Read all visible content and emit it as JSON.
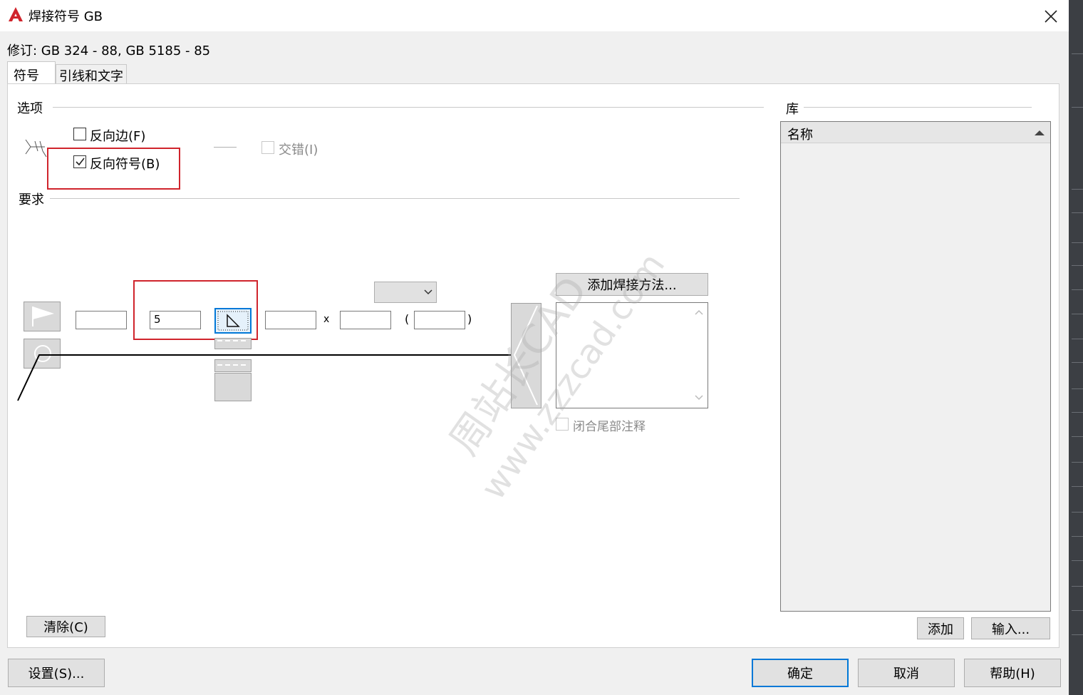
{
  "window": {
    "title": "焊接符号 GB",
    "app_icon": "autocad-logo-icon",
    "close_icon": "close-icon"
  },
  "revision": "修订: GB 324 - 88, GB 5185 - 85",
  "tabs": [
    {
      "label": "符号",
      "active": true
    },
    {
      "label": "引线和文字",
      "active": false
    }
  ],
  "options": {
    "group_label": "选项",
    "reverse_side": {
      "label": "反向边(F)",
      "checked": false
    },
    "reverse_symbol": {
      "label": "反向符号(B)",
      "checked": true
    },
    "stagger": {
      "label": "交错(I)",
      "checked": false,
      "enabled": false
    }
  },
  "requirements": {
    "group_label": "要求",
    "field_1": "",
    "field_2": "5",
    "field_3": "",
    "x_label": "x",
    "field_4": "",
    "paren_open": "(",
    "field_5": "",
    "paren_close": ")",
    "dropdown_value": "",
    "add_method_button": "添加焊接方法...",
    "close_tail_note": {
      "label": "闭合尾部注释",
      "checked": false,
      "enabled": false
    },
    "clear_button": "清除(C)"
  },
  "library": {
    "group_label": "库",
    "column_header": "名称",
    "add_button": "添加",
    "import_button": "输入..."
  },
  "footer": {
    "settings_button": "设置(S)...",
    "ok_button": "确定",
    "cancel_button": "取消",
    "help_button": "帮助(H)"
  },
  "highlight_color": "#d0242c",
  "watermark": {
    "line1": "周站长CAD",
    "line2": "www.zzzcad.com"
  }
}
